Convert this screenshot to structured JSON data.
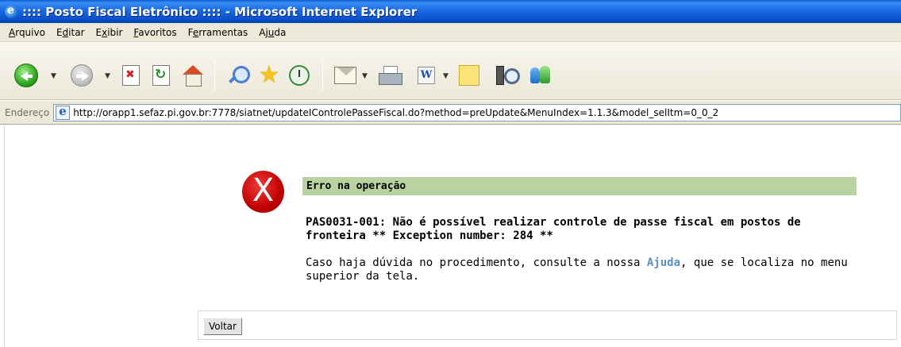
{
  "window": {
    "title": ":::: Posto Fiscal Eletrônico :::: - Microsoft Internet Explorer"
  },
  "menu": {
    "items": [
      {
        "accel": "A",
        "rest": "rquivo"
      },
      {
        "pre": "E",
        "accel": "d",
        "rest": "itar"
      },
      {
        "pre": "E",
        "accel": "x",
        "rest": "ibir"
      },
      {
        "accel": "F",
        "rest": "avoritos"
      },
      {
        "pre": "F",
        "accel": "e",
        "rest": "rramentas"
      },
      {
        "pre": "Aj",
        "accel": "u",
        "rest": "da"
      }
    ]
  },
  "toolbar": {
    "buttons": [
      "back-icon",
      "forward-icon",
      "stop-icon",
      "refresh-icon",
      "home-icon",
      "search-icon",
      "favorites-icon",
      "history-icon",
      "mail-icon",
      "print-icon",
      "word-icon",
      "note-icon",
      "research-icon",
      "messenger-icon"
    ]
  },
  "address": {
    "label": "Endereço",
    "url": "http://orapp1.sefaz.pi.gov.br:7778/siatnet/updateIControlePasseFiscal.do?method=preUpdate&MenuIndex=1.1.3&model_selItm=0_0_2"
  },
  "content": {
    "icon_glyph": "X",
    "header": "Erro na operação",
    "error_line1": "PAS0031-001: Não é possível realizar controle de passe fiscal em postos de",
    "error_line2": "fronteira ** Exception number: 284 **",
    "help_pre": "Caso haja dúvida no procedimento, consulte a nossa ",
    "help_link": "Ajuda",
    "help_post": ", que se localiza no menu",
    "help_line2": "superior da tela.",
    "back_button": "Voltar"
  },
  "colors": {
    "title_bar": "#0a4fc8",
    "header_band": "#b8d3a0",
    "help_link": "#5b8fc3",
    "error_icon": "#c00000"
  }
}
